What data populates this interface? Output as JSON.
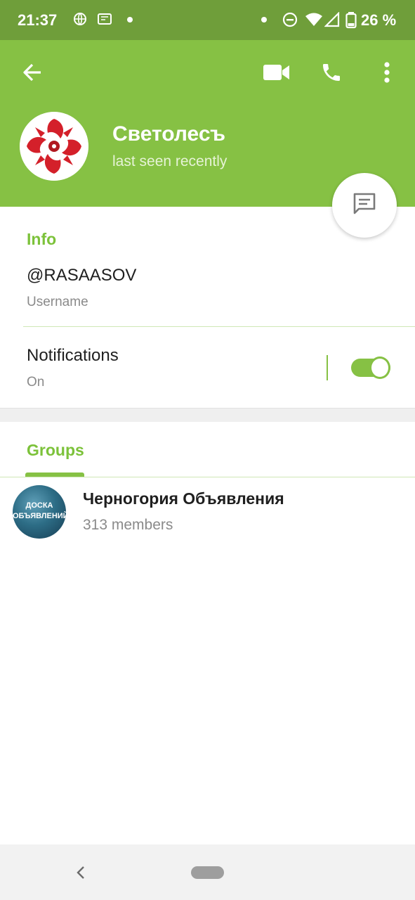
{
  "status_bar": {
    "time": "21:37",
    "battery": "26 %",
    "icons": [
      "vpn-globe-icon",
      "payment-card-icon",
      "notification-dot-icon",
      "dnd-icon",
      "wifi-icon",
      "signal-icon",
      "battery-icon"
    ]
  },
  "header": {
    "back_icon": "arrow-left-icon",
    "video_icon": "video-camera-icon",
    "call_icon": "phone-icon",
    "menu_icon": "more-vert-icon",
    "name": "Светолесъ",
    "status": "last seen recently",
    "fab_icon": "message-icon"
  },
  "info": {
    "title": "Info",
    "username": "@RASAASOV",
    "username_label": "Username",
    "notifications_label": "Notifications",
    "notifications_value": "On",
    "notifications_enabled": true
  },
  "groups": {
    "tab_label": "Groups",
    "items": [
      {
        "name": "Черногория Объявления",
        "members": "313 members",
        "avatar_text": "ДОСКА ОБЪЯВЛЕНИЙ"
      }
    ]
  },
  "nav": {
    "back_icon": "nav-back-icon",
    "home_icon": "home-pill-icon"
  },
  "colors": {
    "primary": "#86c144",
    "status_bar": "#6f9e3a",
    "accent_text": "#7cc23a",
    "secondary_text": "#8a8a8a"
  }
}
